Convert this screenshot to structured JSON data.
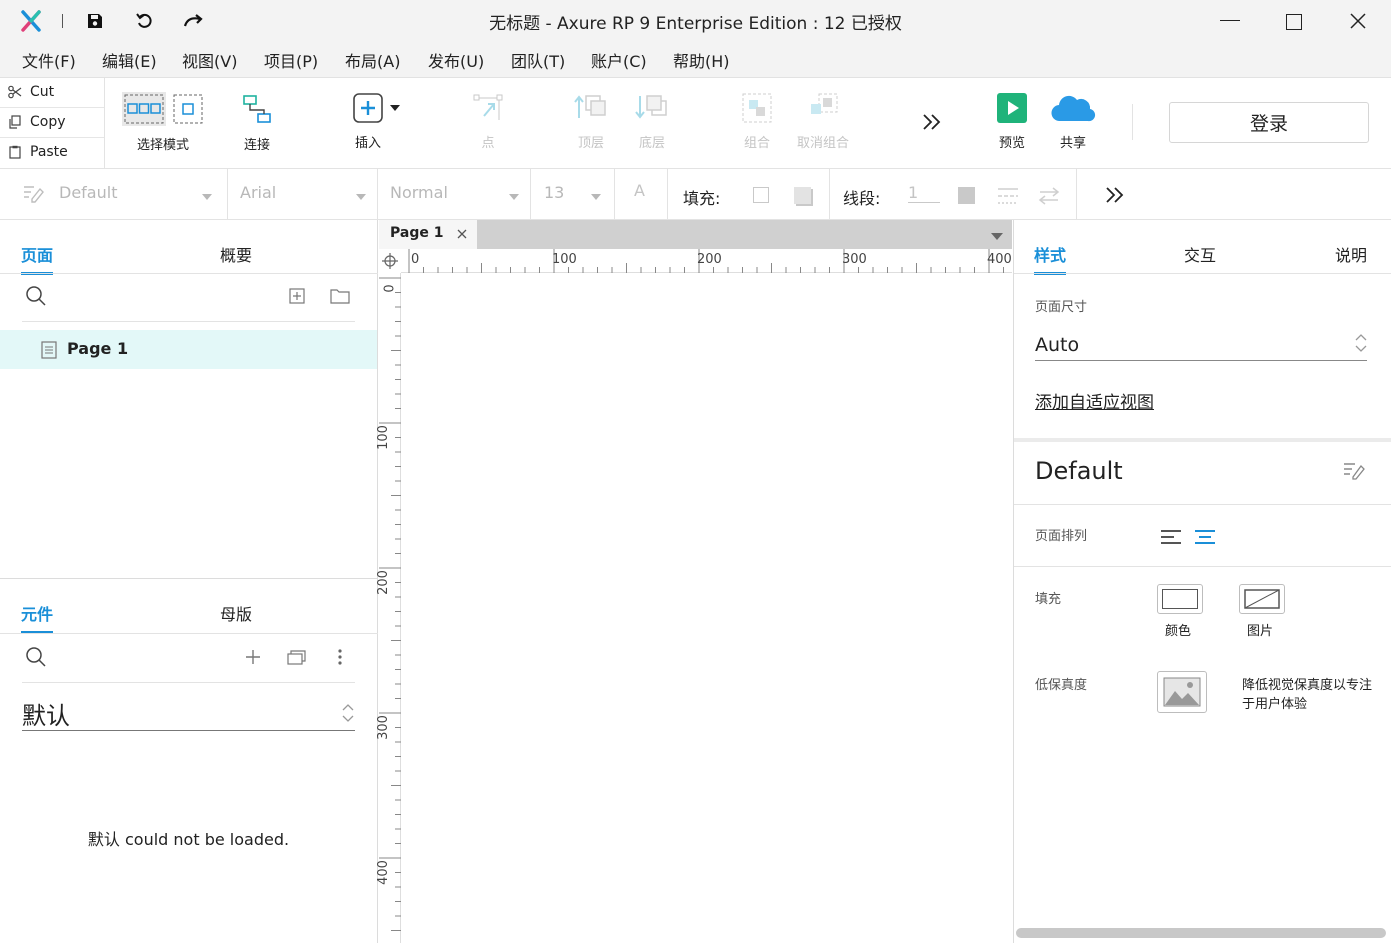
{
  "window": {
    "title": "无标题 - Axure RP 9 Enterprise Edition : 12 已授权"
  },
  "menu": [
    "文件(F)",
    "编辑(E)",
    "视图(V)",
    "项目(P)",
    "布局(A)",
    "发布(U)",
    "团队(T)",
    "账户(C)",
    "帮助(H)"
  ],
  "clipboard": {
    "cut": "Cut",
    "copy": "Copy",
    "paste": "Paste"
  },
  "toolbar": {
    "select_mode": "选择模式",
    "connect": "连接",
    "insert": "插入",
    "point": "点",
    "top_layer": "顶层",
    "bottom_layer": "底层",
    "group": "组合",
    "ungroup": "取消组合",
    "preview": "预览",
    "share": "共享",
    "login": "登录"
  },
  "format": {
    "style": "Default",
    "font": "Arial",
    "weight": "Normal",
    "size": "13",
    "fill_label": "填充:",
    "stroke_label": "线段:",
    "stroke_value": "1"
  },
  "pages_panel": {
    "tab_pages": "页面",
    "tab_outline": "概要",
    "pages": [
      "Page 1"
    ]
  },
  "library_panel": {
    "tab_widgets": "元件",
    "tab_masters": "母版",
    "library_name": "默认",
    "error_message": "默认 could not be loaded."
  },
  "canvas": {
    "tab_label": "Page 1",
    "h_ticks": [
      "0",
      "100",
      "200",
      "300",
      "400"
    ],
    "v_ticks": [
      "0",
      "100",
      "200",
      "300",
      "400"
    ]
  },
  "right_panel": {
    "tab_style": "样式",
    "tab_interact": "交互",
    "tab_notes": "说明",
    "page_size_label": "页面尺寸",
    "page_size_value": "Auto",
    "add_adaptive": "添加自适应视图",
    "style_name": "Default",
    "page_align_label": "页面排列",
    "fill_label": "填充",
    "fill_color": "颜色",
    "fill_image": "图片",
    "low_fidelity_label": "低保真度",
    "low_fidelity_desc_1": "降低视觉保真度以专注",
    "low_fidelity_desc_2": "于用户体验"
  },
  "colors": {
    "accent": "#1a8fd8",
    "selected_row": "#e3f8f8",
    "preview_green": "#1fb37a",
    "share_blue": "#2a9ae6"
  }
}
